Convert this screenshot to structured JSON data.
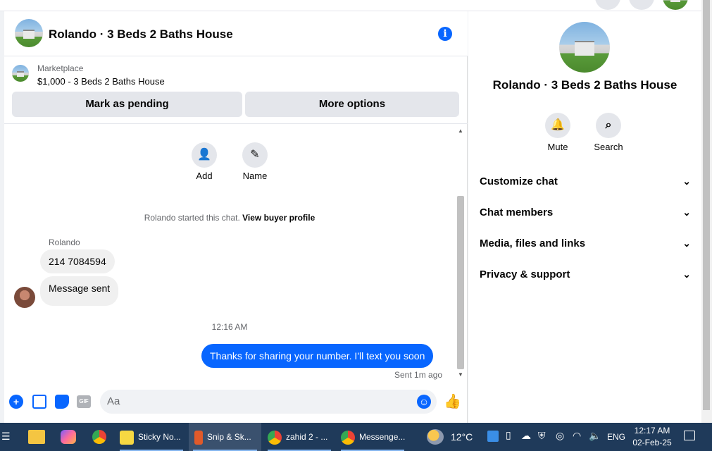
{
  "header": {
    "title": "Rolando · 3 Beds 2 Baths House"
  },
  "marketplace": {
    "label": "Marketplace",
    "listing": "$1,000 - 3 Beds 2 Baths House",
    "pending_btn": "Mark as pending",
    "more_btn": "More options"
  },
  "chat": {
    "actions": [
      {
        "label": "Add"
      },
      {
        "label": "Name"
      }
    ],
    "started_text": "Rolando started this chat.",
    "view_profile": "View buyer profile",
    "sender": "Rolando",
    "messages_in": [
      "214 7084594",
      "Message sent"
    ],
    "time": "12:16 AM",
    "message_out": "Thanks for sharing your number. I'll text you soon",
    "sent_status": "Sent 1m ago"
  },
  "composer": {
    "placeholder": "Aa"
  },
  "right_panel": {
    "name": "Rolando · 3 Beds 2 Baths House",
    "mute": "Mute",
    "search": "Search",
    "sections": [
      "Customize chat",
      "Chat members",
      "Media, files and links",
      "Privacy & support"
    ]
  },
  "taskbar": {
    "apps": [
      "Sticky No...",
      "Snip & Sk...",
      "zahid 2 - ...",
      "Messenge..."
    ],
    "weather": "12°C",
    "lang": "ENG",
    "time": "12:17 AM",
    "date": "02-Feb-25"
  },
  "colors": {
    "accent": "#0866ff",
    "taskbar": "#1f3a5a"
  }
}
